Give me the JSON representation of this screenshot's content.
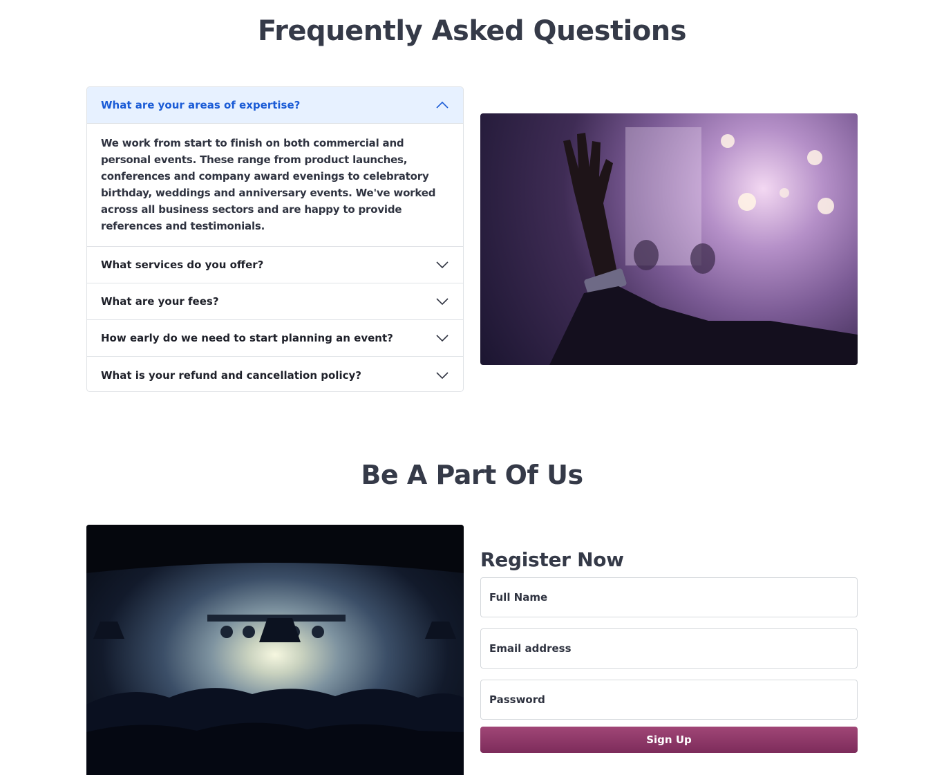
{
  "faq": {
    "title": "Frequently Asked Questions",
    "items": [
      {
        "question": "What are your areas of expertise?",
        "answer": "We work from start to finish on both commercial and personal events. These range from product launches, conferences and company award evenings to celebratory birthday, weddings and anniversary events. We've worked across all business sectors and are happy to provide references and testimonials.",
        "expanded": true
      },
      {
        "question": "What services do you offer?",
        "expanded": false
      },
      {
        "question": "What are your fees?",
        "expanded": false
      },
      {
        "question": "How early do we need to start planning an event?",
        "expanded": false
      },
      {
        "question": "What is your refund and cancellation policy?",
        "expanded": false
      }
    ],
    "image_icon": "raised-hand-photo"
  },
  "join": {
    "title": "Be A Part Of Us",
    "image_icon": "concert-crowd-photo",
    "form": {
      "heading": "Register Now",
      "full_name_placeholder": "Full Name",
      "email_placeholder": "Email address",
      "password_placeholder": "Password",
      "submit_label": "Sign Up"
    }
  },
  "colors": {
    "accent_blue": "#1a5bd6",
    "active_bg": "#e7f1ff",
    "button": "#8d3767"
  }
}
